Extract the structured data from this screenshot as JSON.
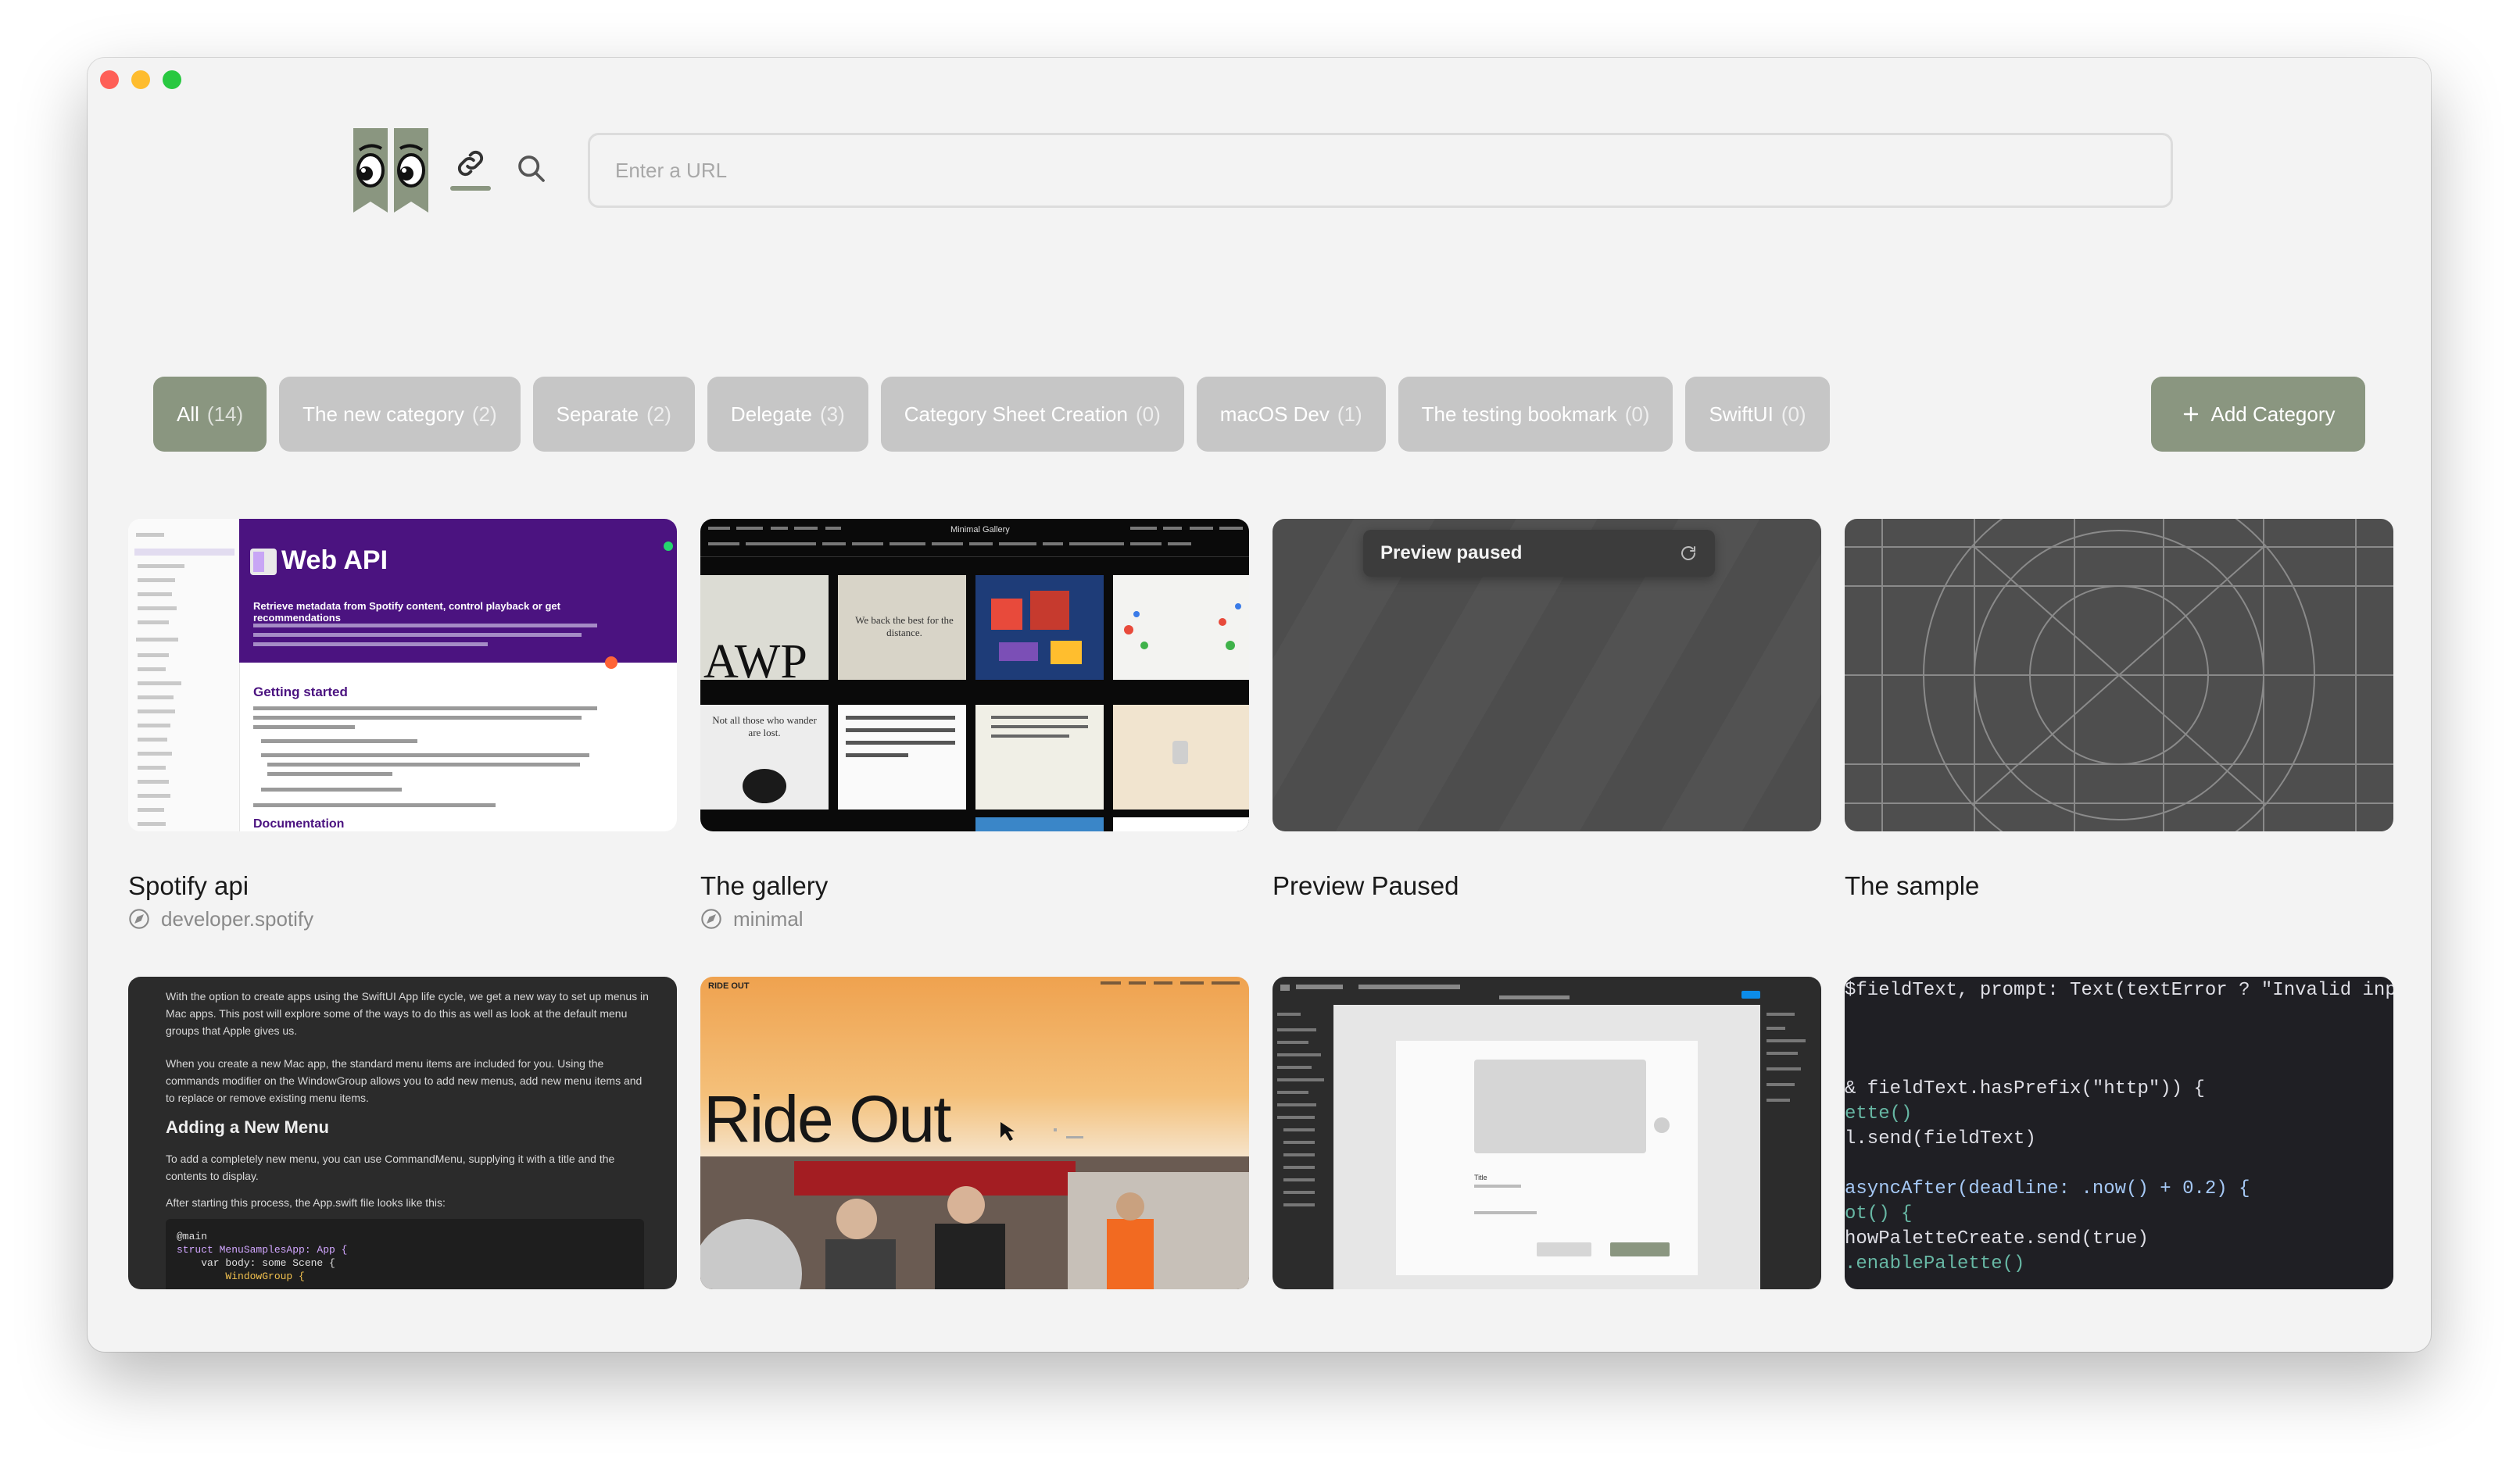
{
  "app": {
    "url_placeholder": "Enter a URL"
  },
  "categories": [
    {
      "label": "All",
      "count": "(14)",
      "active": true
    },
    {
      "label": "The new category",
      "count": "(2)"
    },
    {
      "label": "Separate",
      "count": "(2)"
    },
    {
      "label": "Delegate",
      "count": "(3)"
    },
    {
      "label": "Category Sheet Creation",
      "count": "(0)"
    },
    {
      "label": "macOS Dev",
      "count": "(1)"
    },
    {
      "label": "The testing bookmark",
      "count": "(0)"
    },
    {
      "label": "SwiftUI",
      "count": "(0)"
    }
  ],
  "add_category": {
    "label": "Add Category"
  },
  "bookmarks": [
    {
      "title": "Spotify api",
      "source": "developer.spotify",
      "thumb": {
        "hero_title": "Web API",
        "hero_sub": "Retrieve metadata from Spotify content, control playback or get recommendations",
        "section": "Getting started",
        "section2": "Documentation"
      }
    },
    {
      "title": "The gallery",
      "source": "minimal",
      "thumb": {
        "nav_title": "Minimal Gallery",
        "awp": "AWP",
        "tagline": "We back the best for the distance.",
        "quote": "Not all those who wander are lost."
      }
    },
    {
      "title": "Preview Paused",
      "thumb": {
        "pill": "Preview paused"
      }
    },
    {
      "title": "The sample"
    }
  ],
  "row2": [
    {
      "thumb": {
        "p1": "With the option to create apps using the SwiftUI App life cycle, we get a new way to set up menus in Mac apps. This post will explore some of the ways to do this as well as look at the default menu groups that Apple gives us.",
        "p2": "When you create a new Mac app, the standard menu items are included for you. Using the commands modifier on the WindowGroup allows you to add new menus, add new menu items and to replace or remove existing menu items.",
        "heading": "Adding a New Menu",
        "p3": "To add a completely new menu, you can use CommandMenu, supplying it with a title and the contents to display.",
        "p4": "After starting this process, the App.swift file looks like this:",
        "code1": "@main",
        "code2": "struct MenuSamplesApp: App {",
        "code3": "    var body: some Scene {",
        "code4": "        WindowGroup {"
      }
    },
    {
      "thumb": {
        "brand": "RIDE OUT",
        "headline": "Ride Out"
      }
    },
    {
      "thumb": {
        "frame_label": "Title"
      }
    },
    {
      "thumb": {
        "l1": "$fieldText, prompt: Text(textError ? \"Invalid inpu",
        "l2": "& fieldText.hasPrefix(\"http\")) {",
        "l3": "ette()",
        "l4": "l.send(fieldText)",
        "l5": "asyncAfter(deadline: .now() + 0.2) {",
        "l6": "ot() {",
        "l7": "howPaletteCreate.send(true)",
        "l8": ".enablePalette()"
      }
    }
  ],
  "colors": {
    "accent": "#8a9680",
    "chip_inactive": "#c6c6c6",
    "window_bg": "#f3f3f3"
  }
}
